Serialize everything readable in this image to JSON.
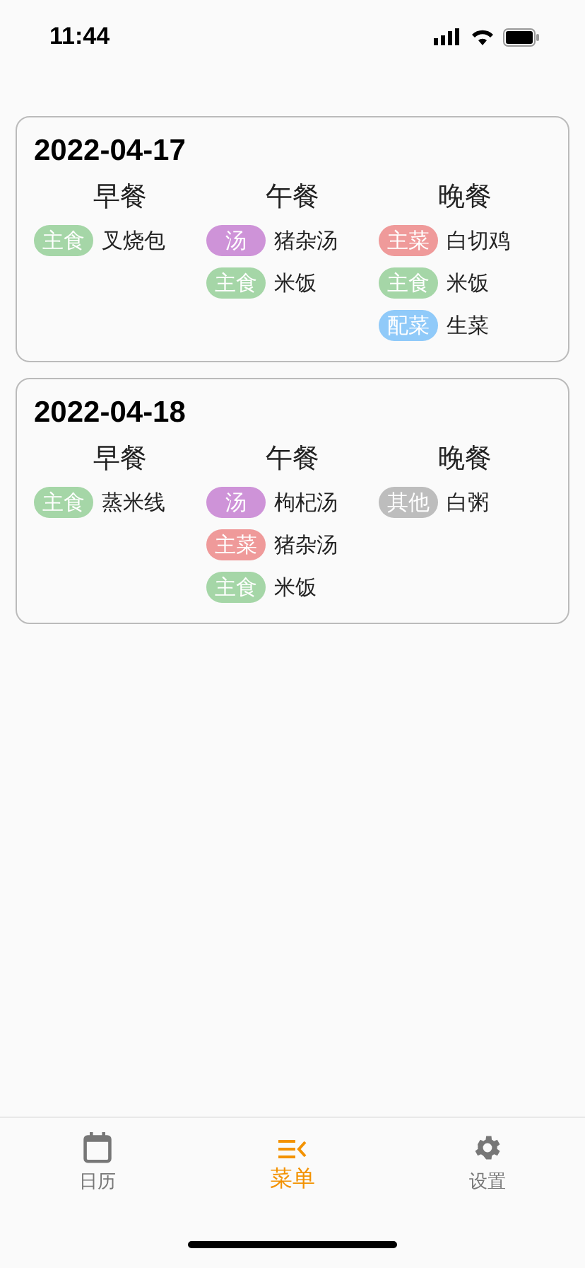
{
  "status_bar": {
    "time": "11:44"
  },
  "days": [
    {
      "date": "2022-04-17",
      "meals": [
        {
          "title": "早餐",
          "items": [
            {
              "tag": "主食",
              "color": "#a5d6a7",
              "name": "叉烧包"
            }
          ]
        },
        {
          "title": "午餐",
          "items": [
            {
              "tag": "汤",
              "color": "#ce93d8",
              "name": "猪杂汤"
            },
            {
              "tag": "主食",
              "color": "#a5d6a7",
              "name": "米饭"
            }
          ]
        },
        {
          "title": "晚餐",
          "items": [
            {
              "tag": "主菜",
              "color": "#ef9a9a",
              "name": "白切鸡"
            },
            {
              "tag": "主食",
              "color": "#a5d6a7",
              "name": "米饭"
            },
            {
              "tag": "配菜",
              "color": "#90caf9",
              "name": "生菜"
            }
          ]
        }
      ]
    },
    {
      "date": "2022-04-18",
      "meals": [
        {
          "title": "早餐",
          "items": [
            {
              "tag": "主食",
              "color": "#a5d6a7",
              "name": "蒸米线"
            }
          ]
        },
        {
          "title": "午餐",
          "items": [
            {
              "tag": "汤",
              "color": "#ce93d8",
              "name": "枸杞汤"
            },
            {
              "tag": "主菜",
              "color": "#ef9a9a",
              "name": "猪杂汤"
            },
            {
              "tag": "主食",
              "color": "#a5d6a7",
              "name": "米饭"
            }
          ]
        },
        {
          "title": "晚餐",
          "items": [
            {
              "tag": "其他",
              "color": "#bdbdbd",
              "name": "白粥"
            }
          ]
        }
      ]
    }
  ],
  "tab_bar": [
    {
      "kind": "calendar",
      "label": "日历",
      "selected": false
    },
    {
      "kind": "menu",
      "label": "菜单",
      "selected": true
    },
    {
      "kind": "settings",
      "label": "设置",
      "selected": false
    }
  ]
}
